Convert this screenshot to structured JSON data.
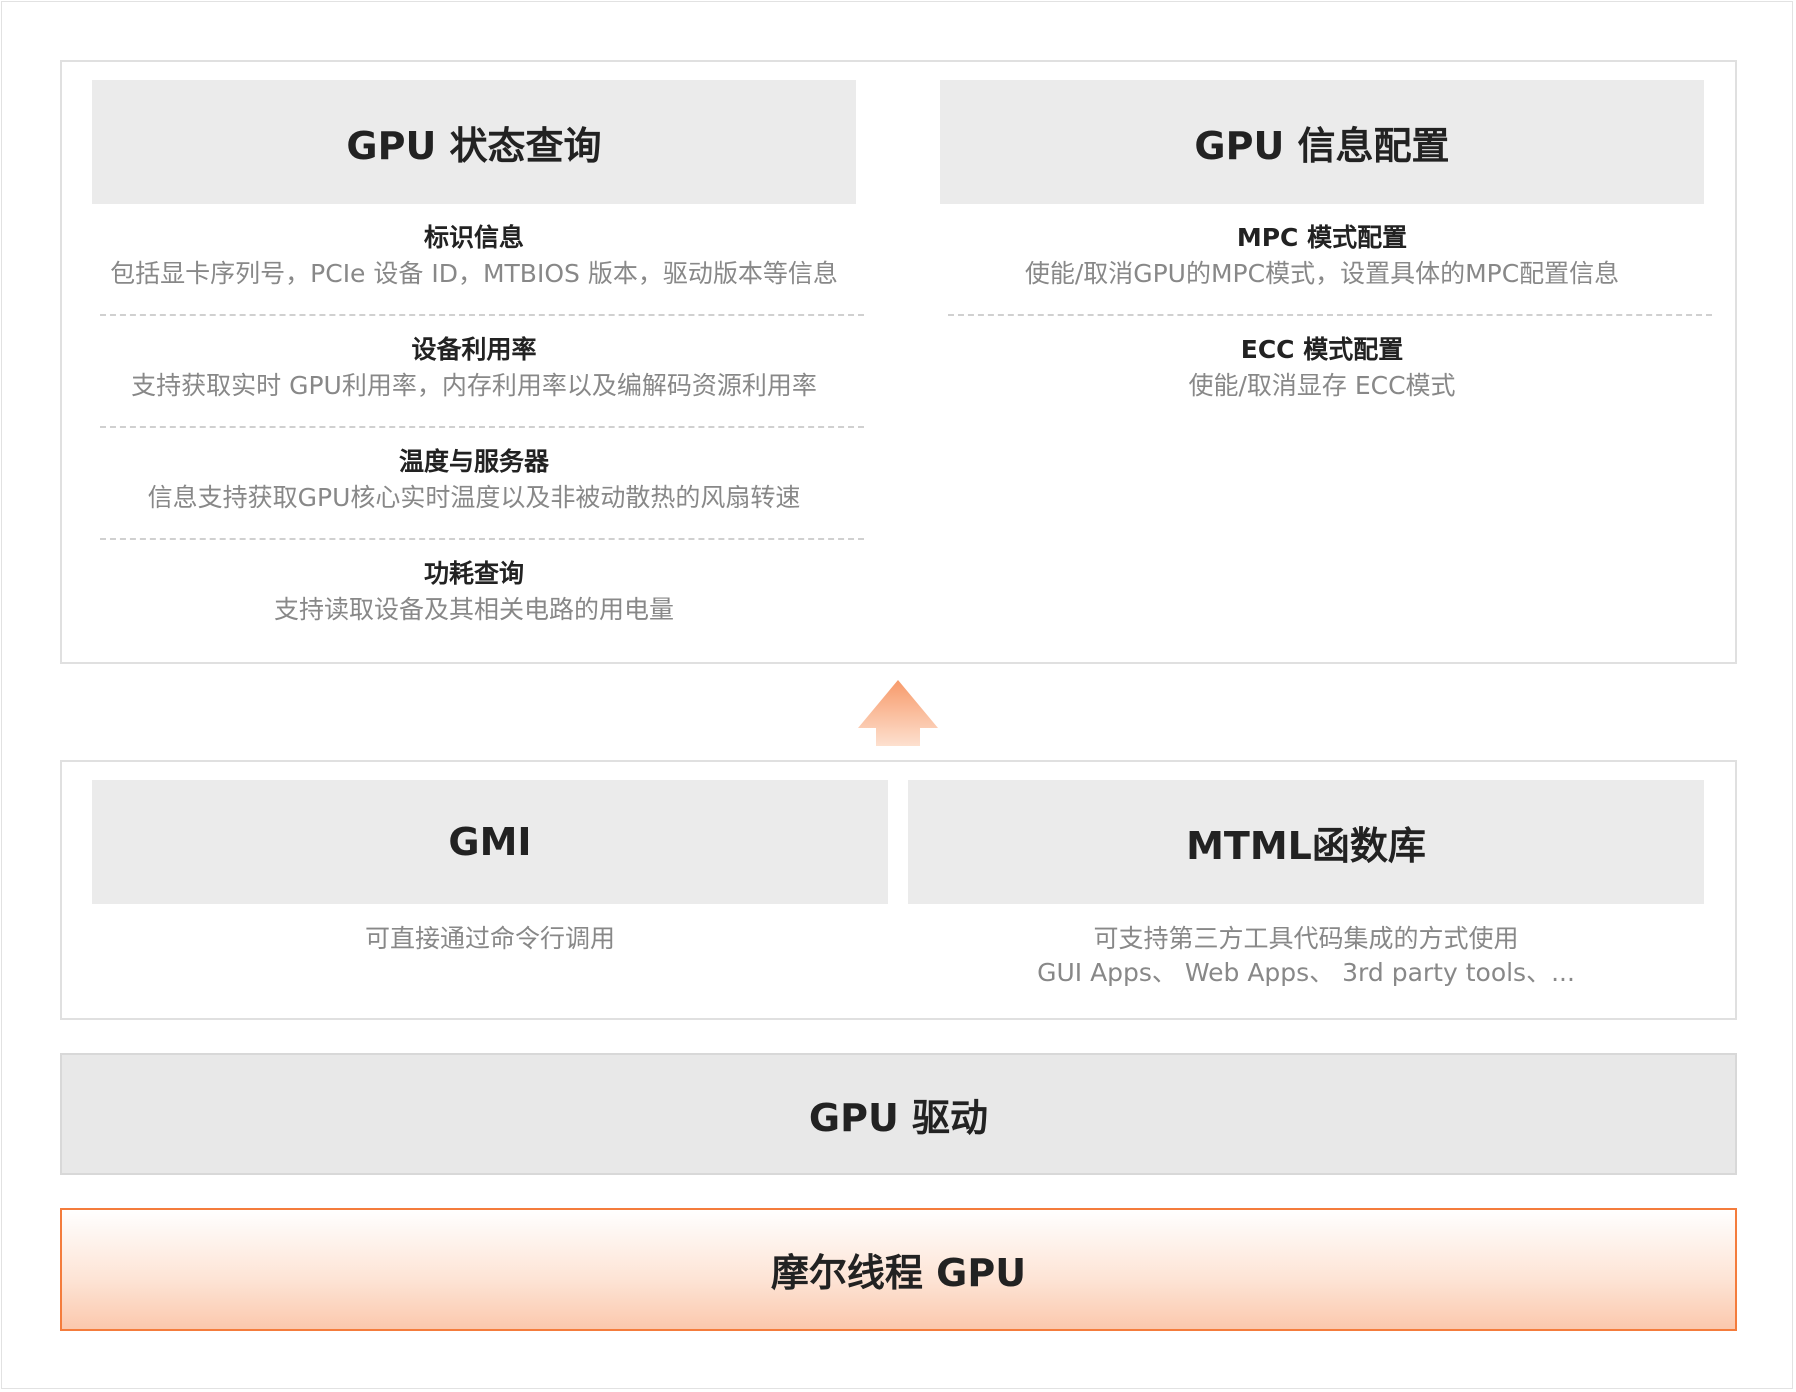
{
  "top_left": {
    "header": "GPU 状态查询",
    "items": [
      {
        "title": "标识信息",
        "desc": "包括显卡序列号，PCIe 设备 ID，MTBIOS 版本，驱动版本等信息"
      },
      {
        "title": "设备利用率",
        "desc": "支持获取实时 GPU利用率，内存利用率以及编解码资源利用率"
      },
      {
        "title": "温度与服务器",
        "desc": "信息支持获取GPU核心实时温度以及非被动散热的风扇转速"
      },
      {
        "title": "功耗查询",
        "desc": "支持读取设备及其相关电路的用电量"
      }
    ]
  },
  "top_right": {
    "header": "GPU 信息配置",
    "items": [
      {
        "title": "MPC 模式配置",
        "desc": "使能/取消GPU的MPC模式，设置具体的MPC配置信息"
      },
      {
        "title": "ECC 模式配置",
        "desc": "使能/取消显存 ECC模式"
      }
    ]
  },
  "middle": {
    "gmi": {
      "header": "GMI",
      "desc": "可直接通过命令行调用"
    },
    "mtml": {
      "header": "MTML函数库",
      "desc": "可支持第三方工具代码集成的方式使用",
      "desc2": "GUI Apps、 Web Apps、 3rd party tools、..."
    }
  },
  "driver": {
    "label": "GPU 驱动"
  },
  "moore": {
    "label": "摩尔线程 GPU"
  },
  "colors": {
    "accent": "#f47c3c",
    "arrow": "#fbb994",
    "header_bg": "#ebebeb"
  }
}
